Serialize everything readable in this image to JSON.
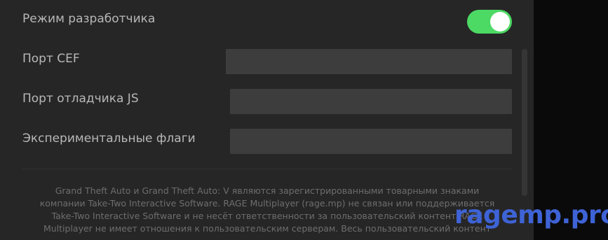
{
  "settings": {
    "developer_mode": {
      "label": "Режим разработчика",
      "enabled": true
    },
    "cef_port": {
      "label": "Порт CEF",
      "value": ""
    },
    "js_debugger_port": {
      "label": "Порт отладчика JS",
      "value": ""
    },
    "experimental_flags": {
      "label": "Экспериментальные флаги",
      "value": ""
    }
  },
  "footer": {
    "line1": "Grand Theft Auto и Grand Theft Auto: V являются зарегистрированными товарными знаками",
    "line2": "компании Take-Two Interactive Software. RAGE Multiplayer (rage.mp) не связан или поддерживается",
    "line3": "Take-Two Interactive Software и не несёт ответственности за пользовательский контент RAGE",
    "line4": "Multiplayer не имеет отношения к пользовательским серверам. Весь пользовательский контент"
  },
  "watermark": "ragemp.pro",
  "colors": {
    "toggle_on": "#4cd964",
    "panel_bg": "#262626",
    "field_bg": "#3d3d3d",
    "watermark": "#3e63d6"
  }
}
